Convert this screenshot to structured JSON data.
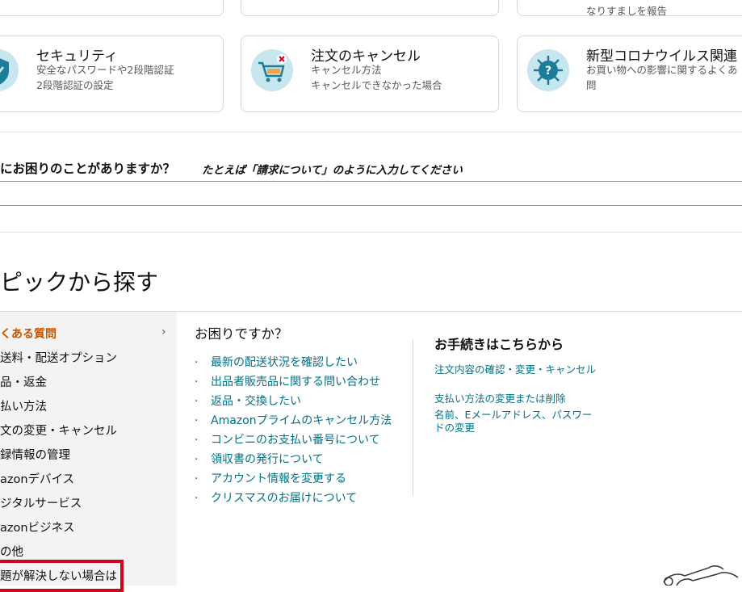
{
  "top_cards_partial": {
    "right_desc": "なりすましを報告"
  },
  "cards": [
    {
      "title": "セキュリティ",
      "desc_lines": [
        "安全なパスワードや2段階認証",
        "2段階認証の設定"
      ],
      "icon": "shield-icon"
    },
    {
      "title": "注文のキャンセル",
      "desc_lines": [
        "キャンセル方法",
        "キャンセルできなかった場合"
      ],
      "icon": "cart-cancel-icon"
    },
    {
      "title": "新型コロナウイルス関連",
      "desc_lines": [
        "お買い物への影響に関するよくあ",
        "問"
      ],
      "icon": "virus-help-icon"
    }
  ],
  "search": {
    "question": "にお困りのことがありますか？",
    "example": "たとえば「請求について」のように入力してください"
  },
  "topics": {
    "title": "ピックから探す",
    "sidebar": [
      {
        "label": "くある質問",
        "active": true
      },
      {
        "label": "送料・配送オプション"
      },
      {
        "label": "品・返金"
      },
      {
        "label": "払い方法"
      },
      {
        "label": "文の変更・キャンセル"
      },
      {
        "label": "録情報の管理"
      },
      {
        "label": "azonデバイス"
      },
      {
        "label": "ジタルサービス"
      },
      {
        "label": "azonビジネス"
      },
      {
        "label": "の他"
      },
      {
        "label": "題が解決しない場合は"
      }
    ],
    "help": {
      "heading": "お困りですか？",
      "links": [
        "最新の配送状況を確認したい",
        "出品者販売品に関する問い合わせ",
        "返品・交換したい",
        "Amazonプライムのキャンセル方法",
        "コンビニのお支払い番号について",
        "領収書の発行について",
        "アカウント情報を変更する",
        "クリスマスのお届けについて"
      ]
    },
    "procedures": {
      "heading": "お手続きはこちらから",
      "links": [
        "注文内容の確認・変更・キャンセル",
        "支払い方法の変更または削除",
        "名前、Eメールアドレス、パスワードの変更"
      ]
    }
  },
  "colors": {
    "accent_orange": "#c45500",
    "link_teal": "#007185",
    "highlight_red": "#d0021b",
    "icon_bg": "#c7e6ee"
  }
}
